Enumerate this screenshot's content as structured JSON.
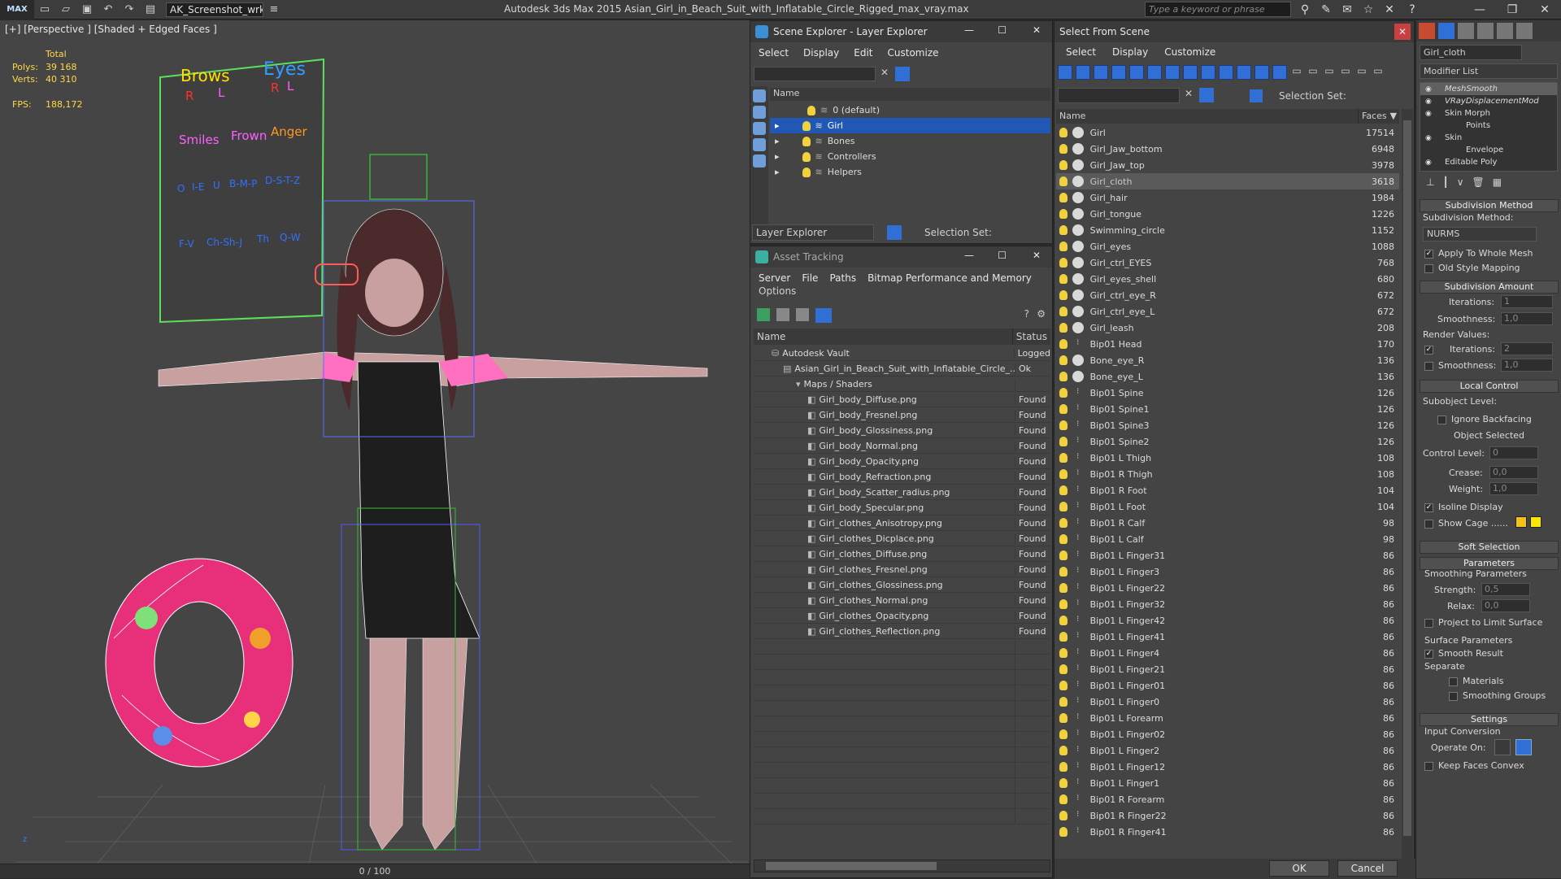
{
  "titlebar": {
    "logo": "MAX",
    "workspace": "AK_Screenshot_wrksp",
    "app_title": "Autodesk 3ds Max  2015     Asian_Girl_in_Beach_Suit_with_Inflatable_Circle_Rigged_max_vray.max",
    "search_placeholder": "Type a keyword or phrase"
  },
  "viewport": {
    "label": "[+] [Perspective ] [Shaded + Edged Faces ]",
    "stats": {
      "total_label": "Total",
      "polys_label": "Polys:",
      "polys": "39 168",
      "verts_label": "Verts:",
      "verts": "40 310",
      "fps_label": "FPS:",
      "fps": "188,172"
    },
    "board": {
      "brows": "Brows",
      "eyes": "Eyes",
      "r": "R",
      "l": "L",
      "smiles": "Smiles",
      "frown": "Frown",
      "anger": "Anger",
      "row1": [
        "O",
        "I-E",
        "U",
        "B-M-P",
        "D-S-T-Z"
      ],
      "row2": [
        "F-V",
        "Ch-Sh-J",
        "Th",
        "Q-W"
      ]
    },
    "timeline": "0 / 100"
  },
  "layer_explorer": {
    "title": "Scene Explorer - Layer Explorer",
    "menu": [
      "Select",
      "Display",
      "Edit",
      "Customize"
    ],
    "column": "Name",
    "layers": [
      {
        "name": "0 (default)",
        "selected": false
      },
      {
        "name": "Girl",
        "selected": true
      },
      {
        "name": "Bones",
        "selected": false
      },
      {
        "name": "Controllers",
        "selected": false
      },
      {
        "name": "Helpers",
        "selected": false
      }
    ],
    "footer_label": "Layer Explorer",
    "selection_set": "Selection Set:"
  },
  "asset_tracking": {
    "title": "Asset Tracking",
    "menu": [
      "Server",
      "File",
      "Paths",
      "Bitmap Performance and Memory"
    ],
    "menu2": "Options",
    "col_name": "Name",
    "col_status": "Status",
    "vault": {
      "name": "Autodesk Vault",
      "status": "Logged"
    },
    "scene_file": {
      "name": "Asian_Girl_in_Beach_Suit_with_Inflatable_Circle_...",
      "status": "Ok"
    },
    "group": "Maps / Shaders",
    "files": [
      {
        "name": "Girl_body_Diffuse.png",
        "status": "Found"
      },
      {
        "name": "Girl_body_Fresnel.png",
        "status": "Found"
      },
      {
        "name": "Girl_body_Glossiness.png",
        "status": "Found"
      },
      {
        "name": "Girl_body_Normal.png",
        "status": "Found"
      },
      {
        "name": "Girl_body_Opacity.png",
        "status": "Found"
      },
      {
        "name": "Girl_body_Refraction.png",
        "status": "Found"
      },
      {
        "name": "Girl_body_Scatter_radius.png",
        "status": "Found"
      },
      {
        "name": "Girl_body_Specular.png",
        "status": "Found"
      },
      {
        "name": "Girl_clothes_Anisotropy.png",
        "status": "Found"
      },
      {
        "name": "Girl_clothes_Dicplace.png",
        "status": "Found"
      },
      {
        "name": "Girl_clothes_Diffuse.png",
        "status": "Found"
      },
      {
        "name": "Girl_clothes_Fresnel.png",
        "status": "Found"
      },
      {
        "name": "Girl_clothes_Glossiness.png",
        "status": "Found"
      },
      {
        "name": "Girl_clothes_Normal.png",
        "status": "Found"
      },
      {
        "name": "Girl_clothes_Opacity.png",
        "status": "Found"
      },
      {
        "name": "Girl_clothes_Reflection.png",
        "status": "Found"
      }
    ]
  },
  "select_from_scene": {
    "title": "Select From Scene",
    "menu": [
      "Select",
      "Display",
      "Customize"
    ],
    "selection_set": "Selection Set:",
    "col_name": "Name",
    "col_faces": "Faces",
    "rows": [
      {
        "name": "Girl",
        "faces": "17514",
        "type": "mesh"
      },
      {
        "name": "Girl_Jaw_bottom",
        "faces": "6948",
        "type": "mesh"
      },
      {
        "name": "Girl_Jaw_top",
        "faces": "3978",
        "type": "mesh"
      },
      {
        "name": "Girl_cloth",
        "faces": "3618",
        "type": "mesh",
        "selected": true
      },
      {
        "name": "Girl_hair",
        "faces": "1984",
        "type": "mesh"
      },
      {
        "name": "Girl_tongue",
        "faces": "1226",
        "type": "mesh"
      },
      {
        "name": "Swimming_circle",
        "faces": "1152",
        "type": "mesh"
      },
      {
        "name": "Girl_eyes",
        "faces": "1088",
        "type": "mesh"
      },
      {
        "name": "Girl_ctrl_EYES",
        "faces": "768",
        "type": "ctrl"
      },
      {
        "name": "Girl_eyes_shell",
        "faces": "680",
        "type": "mesh"
      },
      {
        "name": "Girl_ctrl_eye_R",
        "faces": "672",
        "type": "ctrl"
      },
      {
        "name": "Girl_ctrl_eye_L",
        "faces": "672",
        "type": "ctrl"
      },
      {
        "name": "Girl_leash",
        "faces": "208",
        "type": "mesh"
      },
      {
        "name": "Bip01 Head",
        "faces": "170",
        "type": "bone"
      },
      {
        "name": "Bone_eye_R",
        "faces": "136",
        "type": "mesh"
      },
      {
        "name": "Bone_eye_L",
        "faces": "136",
        "type": "mesh"
      },
      {
        "name": "Bip01 Spine",
        "faces": "126",
        "type": "bone"
      },
      {
        "name": "Bip01 Spine1",
        "faces": "126",
        "type": "bone"
      },
      {
        "name": "Bip01 Spine3",
        "faces": "126",
        "type": "bone"
      },
      {
        "name": "Bip01 Spine2",
        "faces": "126",
        "type": "bone"
      },
      {
        "name": "Bip01 L Thigh",
        "faces": "108",
        "type": "bone"
      },
      {
        "name": "Bip01 R Thigh",
        "faces": "108",
        "type": "bone"
      },
      {
        "name": "Bip01 R Foot",
        "faces": "104",
        "type": "bone"
      },
      {
        "name": "Bip01 L Foot",
        "faces": "104",
        "type": "bone"
      },
      {
        "name": "Bip01 R Calf",
        "faces": "98",
        "type": "bone"
      },
      {
        "name": "Bip01 L Calf",
        "faces": "98",
        "type": "bone"
      },
      {
        "name": "Bip01 L Finger31",
        "faces": "86",
        "type": "bone"
      },
      {
        "name": "Bip01 L Finger3",
        "faces": "86",
        "type": "bone"
      },
      {
        "name": "Bip01 L Finger22",
        "faces": "86",
        "type": "bone"
      },
      {
        "name": "Bip01 L Finger32",
        "faces": "86",
        "type": "bone"
      },
      {
        "name": "Bip01 L Finger42",
        "faces": "86",
        "type": "bone"
      },
      {
        "name": "Bip01 L Finger41",
        "faces": "86",
        "type": "bone"
      },
      {
        "name": "Bip01 L Finger4",
        "faces": "86",
        "type": "bone"
      },
      {
        "name": "Bip01 L Finger21",
        "faces": "86",
        "type": "bone"
      },
      {
        "name": "Bip01 L Finger01",
        "faces": "86",
        "type": "bone"
      },
      {
        "name": "Bip01 L Finger0",
        "faces": "86",
        "type": "bone"
      },
      {
        "name": "Bip01 L Forearm",
        "faces": "86",
        "type": "bone"
      },
      {
        "name": "Bip01 L Finger02",
        "faces": "86",
        "type": "bone"
      },
      {
        "name": "Bip01 L Finger2",
        "faces": "86",
        "type": "bone"
      },
      {
        "name": "Bip01 L Finger12",
        "faces": "86",
        "type": "bone"
      },
      {
        "name": "Bip01 L Finger1",
        "faces": "86",
        "type": "bone"
      },
      {
        "name": "Bip01 R Forearm",
        "faces": "86",
        "type": "bone"
      },
      {
        "name": "Bip01 R Finger22",
        "faces": "86",
        "type": "bone"
      },
      {
        "name": "Bip01 R Finger41",
        "faces": "86",
        "type": "bone"
      }
    ],
    "ok": "OK",
    "cancel": "Cancel"
  },
  "modify_panel": {
    "object_name": "Girl_cloth",
    "modifier_list": "Modifier List",
    "stack": [
      {
        "name": "MeshSmooth",
        "italic": true
      },
      {
        "name": "VRayDisplacementMod",
        "italic": true
      },
      {
        "name": "Skin Morph",
        "italic": false
      },
      {
        "name": "Points",
        "italic": false,
        "child": true
      },
      {
        "name": "Skin",
        "italic": false
      },
      {
        "name": "Envelope",
        "italic": false,
        "child": true
      },
      {
        "name": "Editable Poly",
        "italic": false
      }
    ],
    "subdivision_method": "Subdivision Method",
    "subdivision_method_label": "Subdivision Method:",
    "method_value": "NURMS",
    "apply_whole_mesh": "Apply To Whole Mesh",
    "old_style": "Old Style Mapping",
    "subdivision_amount": "Subdivision Amount",
    "iterations": "Iterations:",
    "iterations_val": "1",
    "smoothness": "Smoothness:",
    "smoothness_val": "1,0",
    "render_values": "Render Values:",
    "r_iterations_val": "2",
    "r_smoothness_val": "1,0",
    "local_control": "Local Control",
    "subobject_level": "Subobject Level:",
    "ignore_backfacing": "Ignore Backfacing",
    "object_selected": "Object Selected",
    "control_level": "Control Level:",
    "control_level_val": "0",
    "crease": "Crease:",
    "crease_val": "0,0",
    "weight": "Weight:",
    "weight_val": "1,0",
    "isoline": "Isoline Display",
    "show_cage": "Show Cage ......",
    "soft_selection": "Soft Selection",
    "parameters": "Parameters",
    "smoothing_params": "Smoothing Parameters",
    "strength": "Strength:",
    "strength_val": "0,5",
    "relax": "Relax:",
    "relax_val": "0,0",
    "project_limit": "Project to Limit Surface",
    "surface_params": "Surface Parameters",
    "smooth_result": "Smooth Result",
    "separate": "Separate",
    "materials": "Materials",
    "smoothing_groups": "Smoothing Groups",
    "settings": "Settings",
    "input_conversion": "Input Conversion",
    "operate_on": "Operate On:",
    "keep_faces_convex": "Keep Faces Convex",
    "cage_color_1": "#f2c21a",
    "cage_color_2": "#ffe600"
  }
}
